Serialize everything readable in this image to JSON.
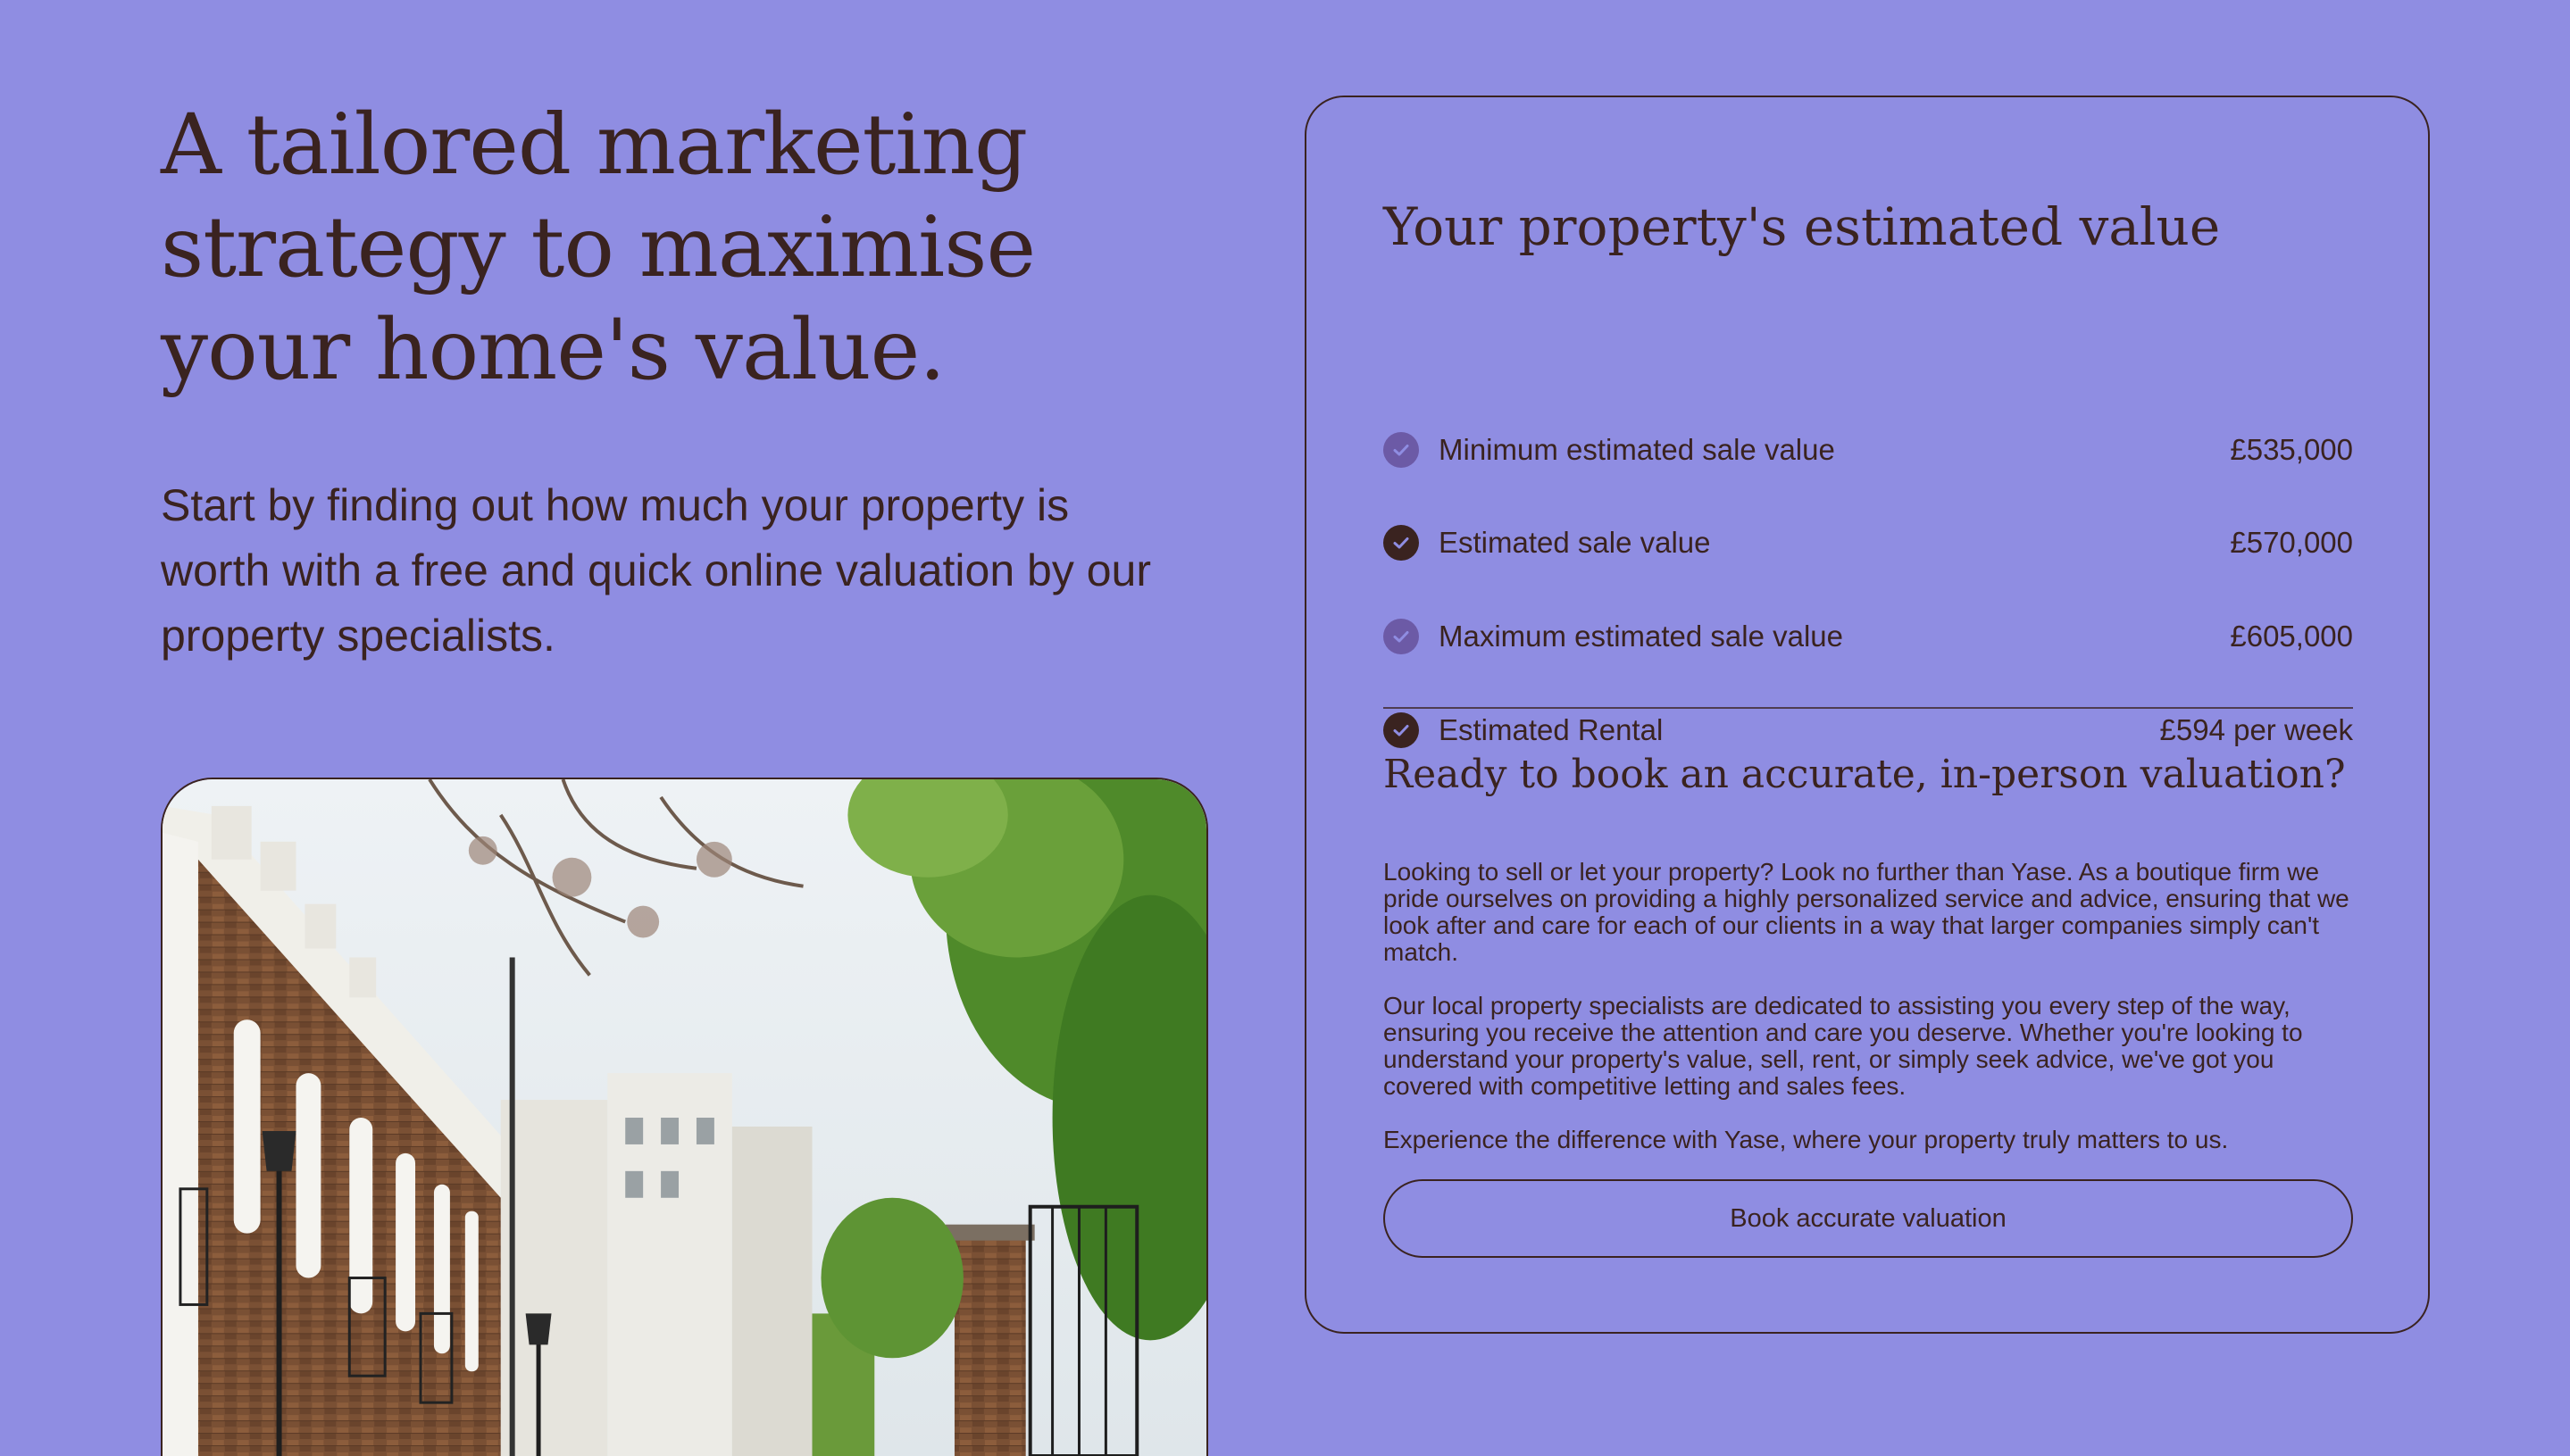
{
  "hero": {
    "headline": "A tailored marketing strategy to maximise your home's value.",
    "intro": "Start by finding out how much your property is worth with a free and quick online valuation by our property specialists."
  },
  "valuation": {
    "title": "Your property's estimated value",
    "items": [
      {
        "label": "Minimum estimated sale value",
        "value": "£535,000",
        "icon": "check-circle-icon",
        "icon_color": "#6c5aa6"
      },
      {
        "label": "Estimated sale value",
        "value": "£570,000",
        "icon": "check-circle-icon",
        "icon_color": "#3a2320"
      },
      {
        "label": "Maximum estimated sale value",
        "value": "£605,000",
        "icon": "check-circle-icon",
        "icon_color": "#6c5aa6"
      },
      {
        "label": "Estimated Rental",
        "value": "£594 per week",
        "icon": "check-circle-icon",
        "icon_color": "#3a2320"
      }
    ]
  },
  "booking": {
    "title": "Ready to book an accurate, in-person valuation?",
    "paragraphs": [
      "Looking to sell or let your property? Look no further than Yase. As a boutique firm we pride ourselves on providing a highly personalized service and advice, ensuring that we look after and care for each of our clients in a way that larger companies simply can't match.",
      "Our local property specialists are dedicated to assisting you every step of the way, ensuring you receive the attention and care you deserve. Whether you're looking to understand your property's value, sell, rent, or simply seek advice, we've got you covered with competitive letting and sales fees.",
      "Experience the difference with Yase, where your property truly matters to us."
    ],
    "button_label": "Book accurate valuation"
  },
  "colors": {
    "background": "#8f8de2",
    "text": "#3a2320",
    "check_light": "#6c5aa6",
    "check_dark": "#3a2320"
  }
}
